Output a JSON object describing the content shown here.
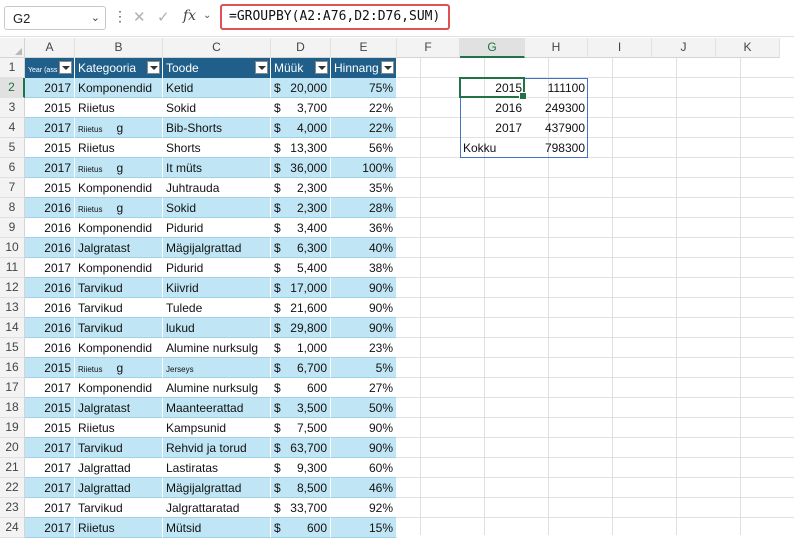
{
  "name_box": "G2",
  "formula": "=GROUPBY(A2:A76,D2:D76,SUM)",
  "columns": [
    "A",
    "B",
    "C",
    "D",
    "E",
    "F",
    "G",
    "H",
    "I",
    "J",
    "K"
  ],
  "selected_column": "G",
  "selected_row": "2",
  "row_numbers": [
    "1",
    "2",
    "3",
    "4",
    "5",
    "6",
    "7",
    "8",
    "9",
    "10",
    "11",
    "12",
    "13",
    "14",
    "15",
    "16",
    "17",
    "18",
    "19",
    "20",
    "21",
    "22",
    "23",
    "24"
  ],
  "table_headers": [
    {
      "label": "Year (ass",
      "tiny": true
    },
    {
      "label": "Kategooria"
    },
    {
      "label": "Toode"
    },
    {
      "label": "Müük"
    },
    {
      "label": "Hinnang"
    }
  ],
  "rows": [
    {
      "year": "2017",
      "cat": "Komponendid",
      "prod": "Ketid",
      "cur": "$",
      "sales": "20,000",
      "pct": "75%"
    },
    {
      "year": "2015",
      "cat": "Riietus",
      "prod": "Sokid",
      "cur": "$",
      "sales": "3,700",
      "pct": "22%"
    },
    {
      "year": "2017",
      "cat": "Riietus",
      "cat_small": true,
      "cat_suffix": "g",
      "prod": "Bib-Shorts",
      "cur": "$",
      "sales": "4,000",
      "pct": "22%"
    },
    {
      "year": "2015",
      "cat": "Riietus",
      "prod": "Shorts",
      "cur": "$",
      "sales": "13,300",
      "pct": "56%"
    },
    {
      "year": "2017",
      "cat": "Riietus",
      "cat_small": true,
      "cat_suffix": "g",
      "prod": "It müts",
      "cur": "$",
      "sales": "36,000",
      "pct": "100%"
    },
    {
      "year": "2015",
      "cat": "Komponendid",
      "prod": "Juhtrauda",
      "cur": "$",
      "sales": "2,300",
      "pct": "35%"
    },
    {
      "year": "2016",
      "cat": "Riietus",
      "cat_small": true,
      "cat_suffix": "g",
      "prod": "Sokid",
      "cur": "$",
      "sales": "2,300",
      "pct": "28%"
    },
    {
      "year": "2016",
      "cat": "Komponendid",
      "prod": "Pidurid",
      "cur": "$",
      "sales": "3,400",
      "pct": "36%"
    },
    {
      "year": "2016",
      "cat": "Jalgratast",
      "prod": "Mägijalgrattad",
      "cur": "$",
      "sales": "6,300",
      "pct": "40%"
    },
    {
      "year": "2017",
      "cat": "Komponendid",
      "prod": "Pidurid",
      "cur": "$",
      "sales": "5,400",
      "pct": "38%"
    },
    {
      "year": "2016",
      "cat": "Tarvikud",
      "prod": "Kiivrid",
      "cur": "$",
      "sales": "17,000",
      "pct": "90%"
    },
    {
      "year": "2016",
      "cat": "Tarvikud",
      "prod": "Tulede",
      "cur": "$",
      "sales": "21,600",
      "pct": "90%"
    },
    {
      "year": "2016",
      "cat": "Tarvikud",
      "prod": "lukud",
      "cur": "$",
      "sales": "29,800",
      "pct": "90%"
    },
    {
      "year": "2016",
      "cat": "Komponendid",
      "prod": "Alumine nurksulg",
      "cur": "$",
      "sales": "1,000",
      "pct": "23%"
    },
    {
      "year": "2015",
      "cat": "Riietus",
      "cat_small": true,
      "cat_suffix": "g",
      "prod": "Jerseys",
      "prod_small": true,
      "cur": "$",
      "sales": "6,700",
      "pct": "5%"
    },
    {
      "year": "2017",
      "cat": "Komponendid",
      "prod": "Alumine nurksulg",
      "cur": "$",
      "sales": "600",
      "pct": "27%"
    },
    {
      "year": "2015",
      "cat": "Jalgratast",
      "prod": "Maanteerattad",
      "cur": "$",
      "sales": "3,500",
      "pct": "50%"
    },
    {
      "year": "2015",
      "cat": "Riietus",
      "prod": "Kampsunid",
      "cur": "$",
      "sales": "7,500",
      "pct": "90%"
    },
    {
      "year": "2017",
      "cat": "Tarvikud",
      "prod": "Rehvid ja torud",
      "cur": "$",
      "sales": "63,700",
      "pct": "90%"
    },
    {
      "year": "2017",
      "cat": "Jalgrattad",
      "prod": "Lastiratas",
      "cur": "$",
      "sales": "9,300",
      "pct": "60%"
    },
    {
      "year": "2017",
      "cat": "Jalgrattad",
      "prod": "Mägijalgrattad",
      "cur": "$",
      "sales": "8,500",
      "pct": "46%"
    },
    {
      "year": "2017",
      "cat": "Tarvikud",
      "prod": "Jalgrattaratad",
      "cur": "$",
      "sales": "33,700",
      "pct": "92%"
    },
    {
      "year": "2017",
      "cat": "Riietus",
      "prod": "Mütsid",
      "cur": "$",
      "sales": "600",
      "pct": "15%"
    }
  ],
  "groupby": [
    {
      "key": "2015",
      "value": "111100"
    },
    {
      "key": "2016",
      "value": "249300"
    },
    {
      "key": "2017",
      "value": "437900"
    },
    {
      "key": "Kokku",
      "value": "798300"
    }
  ]
}
